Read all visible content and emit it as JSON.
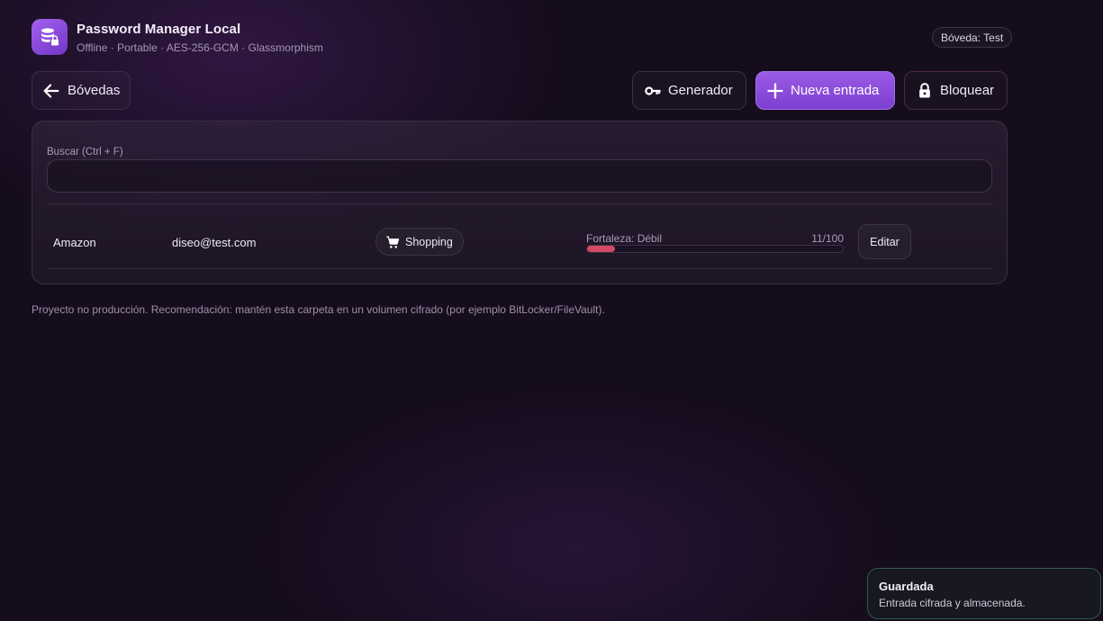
{
  "header": {
    "title": "Password Manager Local",
    "subtitle": "Offline · Portable · AES-256-GCM · Glassmorphism",
    "vault_badge": "Bóveda: Test",
    "logo_icon": "database-lock-icon"
  },
  "toolbar": {
    "back_label": "Bóvedas",
    "generator_label": "Generador",
    "new_entry_label": "Nueva entrada",
    "lock_label": "Bloquear"
  },
  "search": {
    "label": "Buscar (Ctrl + F)",
    "value": "",
    "placeholder": ""
  },
  "entries": [
    {
      "name": "Amazon",
      "username": "diseo@test.com",
      "category": "Shopping",
      "category_icon": "cart-icon",
      "strength_label": "Fortaleza: Débil",
      "strength_score": "11/100",
      "strength_value": 11,
      "edit_label": "Editar"
    }
  ],
  "footnote": "Proyecto no producción. Recomendación: mantén esta carpeta en un volumen cifrado (por ejemplo BitLocker/FileVault).",
  "toast": {
    "title": "Guardada",
    "message": "Entrada cifrada y almacenada."
  },
  "colors": {
    "accent": "#8b4ddc",
    "strength_weak": "#d24a63",
    "background": "#150c1c"
  }
}
